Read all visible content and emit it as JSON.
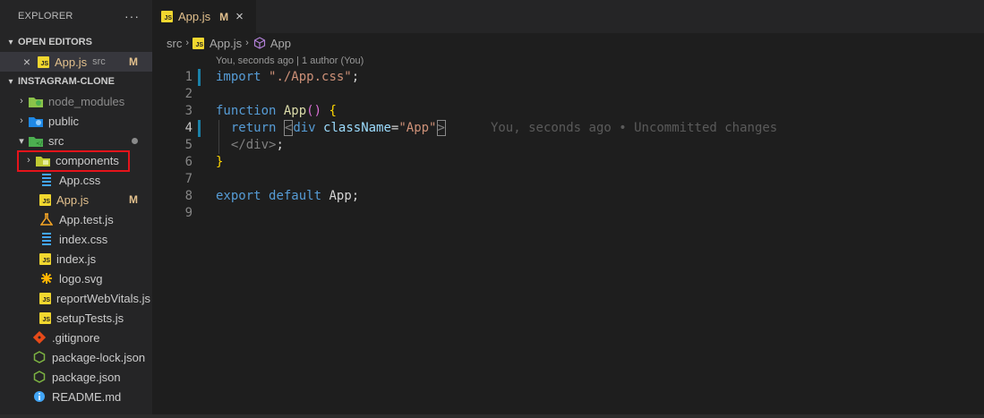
{
  "sidebar": {
    "title": "EXPLORER",
    "more_icon": "ellipsis-icon",
    "open_editors": {
      "label": "OPEN EDITORS",
      "items": [
        {
          "name": "App.js",
          "path": "src",
          "badge": "M"
        }
      ]
    },
    "project": {
      "label": "INSTAGRAM-CLONE",
      "folders": {
        "node_modules": "node_modules",
        "public": "public",
        "src": "src",
        "components": "components"
      },
      "src_files": [
        {
          "name": "App.css",
          "icon": "css-icon"
        },
        {
          "name": "App.js",
          "icon": "js-icon",
          "badge": "M"
        },
        {
          "name": "App.test.js",
          "icon": "flask-icon"
        },
        {
          "name": "index.css",
          "icon": "css-icon"
        },
        {
          "name": "index.js",
          "icon": "js-icon"
        },
        {
          "name": "logo.svg",
          "icon": "svg-icon"
        },
        {
          "name": "reportWebVitals.js",
          "icon": "js-icon"
        },
        {
          "name": "setupTests.js",
          "icon": "js-icon"
        }
      ],
      "root_files": [
        {
          "name": ".gitignore",
          "icon": "git-icon"
        },
        {
          "name": "package-lock.json",
          "icon": "node-icon"
        },
        {
          "name": "package.json",
          "icon": "node-icon"
        },
        {
          "name": "README.md",
          "icon": "info-icon"
        }
      ]
    }
  },
  "editor": {
    "tab": {
      "label": "App.js",
      "badge": "M",
      "close": "×"
    },
    "breadcrumb": {
      "folder": "src",
      "file": "App.js",
      "symbol": "App"
    },
    "codelens": "You, seconds ago | 1 author (You)",
    "lines": {
      "l1": {
        "num": "1",
        "kw": "import",
        "str": "\"./App.css\"",
        "end": ";"
      },
      "l2": {
        "num": "2"
      },
      "l3": {
        "num": "3",
        "kw": "function",
        "fn": "App",
        "paren": "()",
        "brace": "{"
      },
      "l4": {
        "num": "4",
        "kw": "return",
        "lt": "<",
        "tag": "div",
        "attr": "className",
        "eq": "=",
        "str": "\"App\"",
        "gt": ">",
        "blame": "You, seconds ago • Uncommitted changes"
      },
      "l5": {
        "num": "5",
        "tag": "</div>",
        "end": ";"
      },
      "l6": {
        "num": "6",
        "brace": "}"
      },
      "l7": {
        "num": "7"
      },
      "l8": {
        "num": "8",
        "kw1": "export",
        "kw2": "default",
        "name": "App",
        "end": ";"
      },
      "l9": {
        "num": "9"
      }
    }
  },
  "colors": {
    "accent_modified": "#e2c08d",
    "highlight_box": "#e5141b",
    "keyword": "#569cd6",
    "string": "#ce9178"
  }
}
